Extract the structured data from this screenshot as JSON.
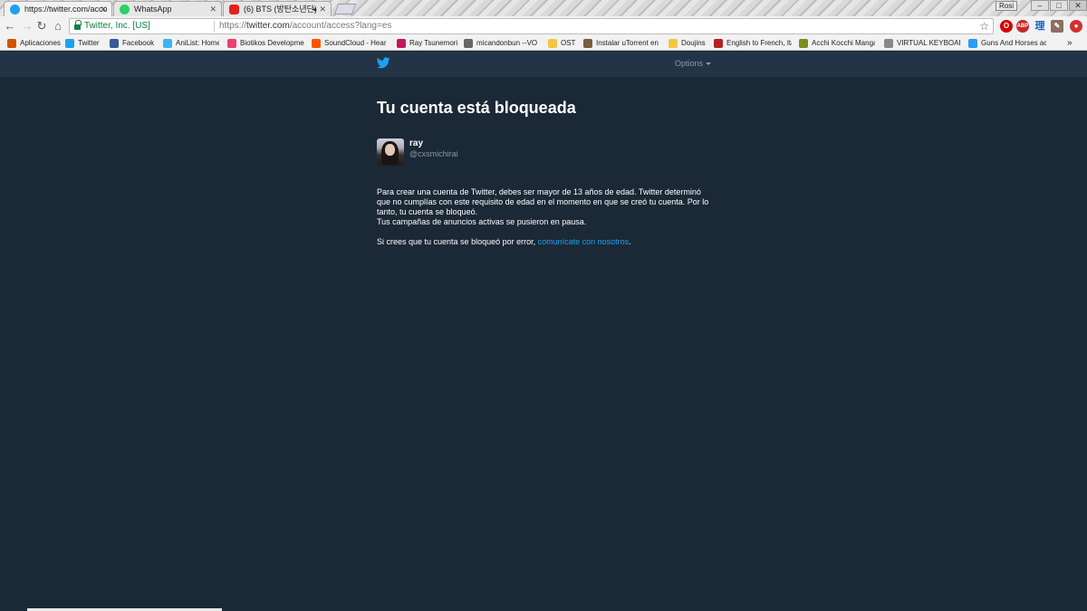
{
  "browser": {
    "tabs": [
      {
        "title": "https://twitter.com/acco",
        "active": true,
        "icon": "twitter-icon"
      },
      {
        "title": "WhatsApp",
        "active": false,
        "icon": "whatsapp-icon"
      },
      {
        "title": "(6) BTS (방탄소년단)",
        "active": false,
        "icon": "youtube-icon"
      }
    ],
    "window_user": "Rosi",
    "security_label": "Twitter, Inc. [US]",
    "url_scheme": "https://",
    "url_host": "twitter.com",
    "url_path": "/account/access?lang=es",
    "bookmarks": [
      {
        "label": "Aplicaciones",
        "icon": "apps-grid-icon",
        "color": "#d35400"
      },
      {
        "label": "Twitter",
        "icon": "twitter-icon",
        "color": "#1da1f2"
      },
      {
        "label": "Facebook",
        "icon": "facebook-icon",
        "color": "#3b5998"
      },
      {
        "label": "AniList: Home",
        "icon": "anilist-icon",
        "color": "#3db4f2"
      },
      {
        "label": "Biotikos Developme",
        "icon": "biotikos-icon",
        "color": "#e9416f"
      },
      {
        "label": "SoundCloud - Hear",
        "icon": "soundcloud-icon",
        "color": "#ff5500"
      },
      {
        "label": "Ray Tsunemori",
        "icon": "ray-icon",
        "color": "#c2185b"
      },
      {
        "label": "micandonbun --VO",
        "icon": "music-note-icon",
        "color": "#666666"
      },
      {
        "label": "OST",
        "icon": "folder-icon",
        "color": "#f4c542"
      },
      {
        "label": "Instalar uTorrent en",
        "icon": "utorrent-icon",
        "color": "#7a5c3e"
      },
      {
        "label": "Doujins",
        "icon": "folder-icon",
        "color": "#f4c542"
      },
      {
        "label": "English to French, Ita",
        "icon": "wr-icon",
        "color": "#b22222"
      },
      {
        "label": "Acchi Kocchi Manga",
        "icon": "manga-icon",
        "color": "#7a8f1e"
      },
      {
        "label": "VIRTUAL KEYBOARD",
        "icon": "page-icon",
        "color": "#888888"
      },
      {
        "label": "Guns And Horses ac",
        "icon": "music-note-icon",
        "color": "#2a9df4"
      }
    ],
    "bookmarks_overflow": "»"
  },
  "twitter": {
    "options_label": "Options",
    "heading": "Tu cuenta está bloqueada",
    "user": {
      "name": "ray",
      "handle": "@cxsmichirai"
    },
    "paragraph1": "Para crear una cuenta de Twitter, debes ser mayor de 13 años de edad. Twitter determinó que no cumplías con este requisito de edad en el momento en que se creó tu cuenta. Por lo tanto, tu cuenta se bloqueó.",
    "paragraph2": "Tus campañas de anuncios activas se pusieron en pausa.",
    "error_prefix": "Si crees que tu cuenta se bloqueó por error, ",
    "contact_link": "comunícate con nosotros",
    "error_suffix": ".",
    "colors": {
      "background": "#1b2836",
      "topbar": "#243447",
      "link": "#1da1f2",
      "muted": "#8899a6"
    }
  }
}
